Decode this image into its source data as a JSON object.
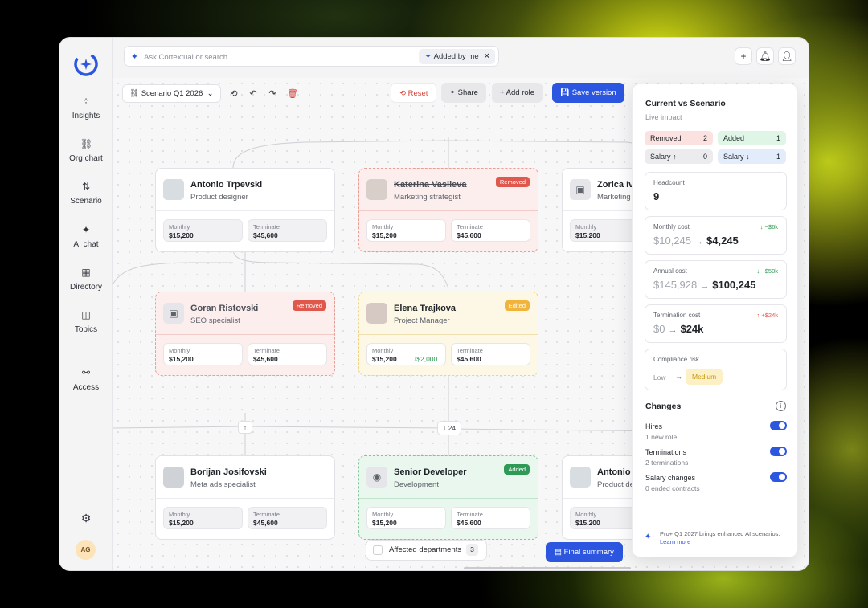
{
  "search": {
    "placeholder": "Ask Cortextual or search...",
    "chip": "Added by me"
  },
  "sidebar": {
    "items": [
      {
        "label": "Insights"
      },
      {
        "label": "Org chart"
      },
      {
        "label": "Scenario"
      },
      {
        "label": "AI chat"
      },
      {
        "label": "Directory"
      },
      {
        "label": "Topics"
      },
      {
        "label": "Access"
      }
    ],
    "avatar": "AG"
  },
  "toolbar": {
    "scenario": "Scenario Q1 2026",
    "reset": "Reset",
    "share": "Share",
    "add_role": "Add role",
    "save": "Save version"
  },
  "cards": [
    {
      "name": "Antonio Trpevski",
      "role": "Product designer",
      "monthly_label": "Monthly",
      "monthly": "$15,200",
      "terminate_label": "Terminate",
      "terminate": "$45,600"
    },
    {
      "name": "Katerina Vasileva",
      "role": "Marketing strategist",
      "badge": "Removed",
      "monthly_label": "Monthly",
      "monthly": "$15,200",
      "terminate_label": "Terminate",
      "terminate": "$45,600"
    },
    {
      "name": "Zorica Iv",
      "role": "Marketing",
      "monthly_label": "Monthly",
      "monthly": "$15,200"
    },
    {
      "name": "Goran Ristovski",
      "role": "SEO specialist",
      "badge": "Removed",
      "monthly_label": "Monthly",
      "monthly": "$15,200",
      "terminate_label": "Terminate",
      "terminate": "$45,600"
    },
    {
      "name": "Elena Trajkova",
      "role": "Project Manager",
      "badge": "Edited",
      "monthly_label": "Monthly",
      "monthly": "$15,200",
      "monthly_delta": "↓$2,000",
      "terminate_label": "Terminate",
      "terminate": "$45,600"
    },
    {
      "name": "Borijan Josifovski",
      "role": "Meta ads specialist",
      "monthly_label": "Monthly",
      "monthly": "$15,200",
      "terminate_label": "Terminate",
      "terminate": "$45,600"
    },
    {
      "name": "Senior Developer",
      "role": "Development",
      "badge": "Added",
      "monthly_label": "Monthly",
      "monthly": "$15,200",
      "terminate_label": "Terminate",
      "terminate": "$45,600"
    },
    {
      "name": "Antonio T",
      "role": "Product de",
      "monthly_label": "Monthly",
      "monthly": "$15,200"
    }
  ],
  "connectors": {
    "collapse_count": "24"
  },
  "bottom": {
    "affected_label": "Affected departments",
    "affected_count": "3",
    "final": "Final summary"
  },
  "panel": {
    "title": "Current vs Scenario",
    "subtitle": "Live impact",
    "tags": {
      "removed": {
        "label": "Removed",
        "count": "2"
      },
      "added": {
        "label": "Added",
        "count": "1"
      },
      "salary_up": {
        "label": "Salary ↑",
        "count": "0"
      },
      "salary_down": {
        "label": "Salary ↓",
        "count": "1"
      }
    },
    "headcount": {
      "label": "Headcount",
      "value": "9"
    },
    "monthly": {
      "label": "Monthly cost",
      "old": "$10,245",
      "new": "$4,245",
      "delta": "↓ −$6k"
    },
    "annual": {
      "label": "Annual cost",
      "old": "$145,928",
      "new": "$100,245",
      "delta": "↓ −$50k"
    },
    "termination": {
      "label": "Termination cost",
      "old": "$0",
      "new": "$24k",
      "delta": "↑ +$24k"
    },
    "risk": {
      "label": "Compliance risk",
      "from": "Low",
      "to": "Medium"
    },
    "changes_title": "Changes",
    "changes": [
      {
        "title": "Hires",
        "sub": "1 new role",
        "on": true
      },
      {
        "title": "Terminations",
        "sub": "2 terminations",
        "on": true
      },
      {
        "title": "Salary changes",
        "sub": "0 ended contracts",
        "on": true
      }
    ],
    "promo": {
      "text": "Pro+ Q1 2027 brings enhanced AI scenarios.",
      "link": "Learn more"
    }
  },
  "colors": {
    "accent": "#2c56e0",
    "removed": "#e0574c",
    "edited": "#f0b43c",
    "added": "#2f9a55"
  }
}
